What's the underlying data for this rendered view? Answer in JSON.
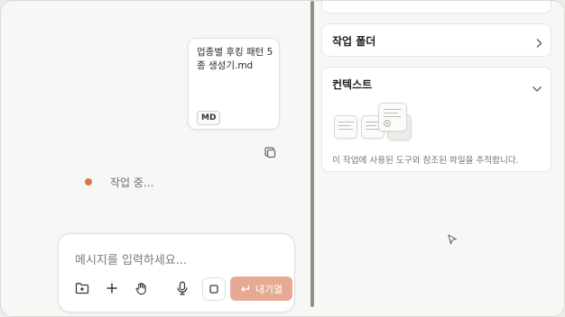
{
  "chat": {
    "file_card": {
      "name": "업종별 후킹 패턴 5종 생성기.md",
      "badge": "MD"
    },
    "status_text": "작업 중...",
    "composer": {
      "placeholder": "메시지를 입력하세요...",
      "send_label": "내기열",
      "tools": [
        "add-folder-icon",
        "plus-icon",
        "hand-icon",
        "microphone-icon"
      ]
    }
  },
  "panel": {
    "working_folder": {
      "title": "작업 폴더"
    },
    "context": {
      "title": "컨텍스트",
      "description": "이 작업에 사용된 도구와 참조된 파일을 추적합니다."
    }
  },
  "colors": {
    "status_dot": "#d9764f",
    "send_button": "#e6aa94",
    "divider": "#8f8f8c"
  }
}
